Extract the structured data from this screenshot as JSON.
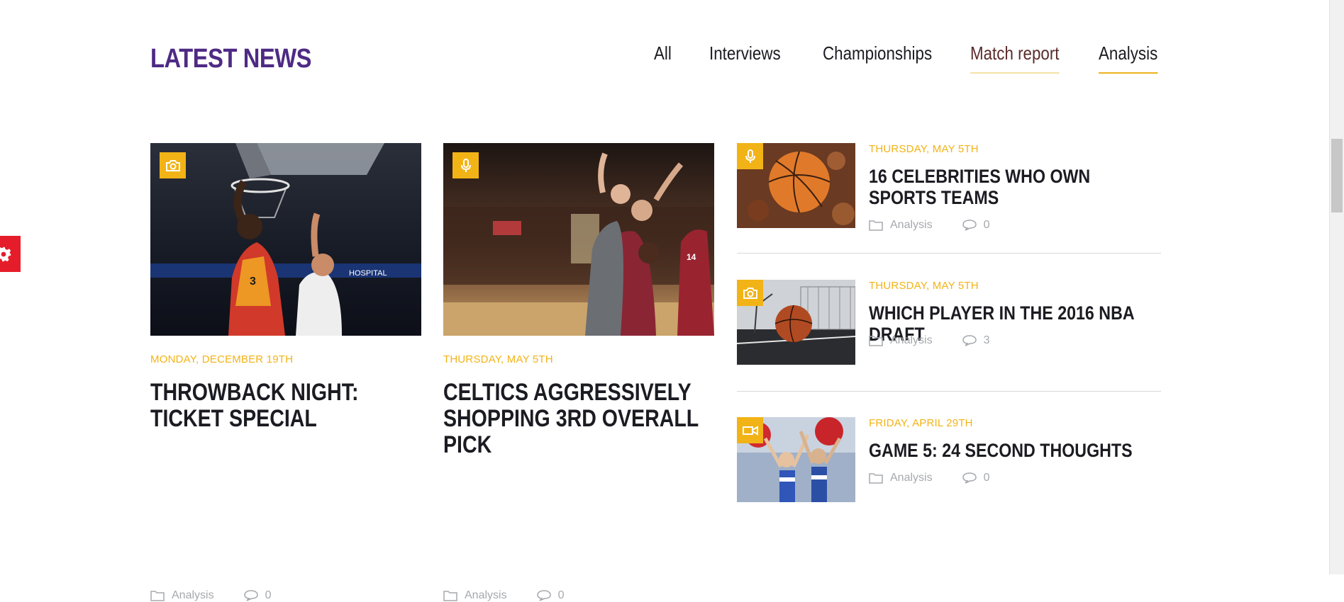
{
  "header": {
    "title": "LATEST NEWS"
  },
  "filter_tabs": [
    {
      "label": "All",
      "state": "normal"
    },
    {
      "label": "Interviews",
      "state": "normal"
    },
    {
      "label": "Championships",
      "state": "normal"
    },
    {
      "label": "Match report",
      "state": "hover"
    },
    {
      "label": "Analysis",
      "state": "active"
    }
  ],
  "colors": {
    "title_purple": "#4e2a84",
    "accent_yellow": "#f2b316",
    "settings_red": "#e51d2a",
    "meta_gray": "#a5a8ad"
  },
  "cards": [
    {
      "badge_icon": "camera-icon",
      "date": "MONDAY, DECEMBER 19TH",
      "title": "THROWBACK NIGHT: TICKET SPECIAL",
      "category": "Analysis",
      "comments": "0"
    },
    {
      "badge_icon": "microphone-icon",
      "date": "THURSDAY, MAY 5TH",
      "title": "CELTICS AGGRESSIVELY SHOPPING 3RD OVERALL PICK",
      "category": "Analysis",
      "comments": "0"
    }
  ],
  "side_list": [
    {
      "badge_icon": "microphone-icon",
      "date": "THURSDAY, MAY 5TH",
      "title": "16 CELEBRITIES WHO OWN SPORTS TEAMS",
      "category": "Analysis",
      "comments": "0"
    },
    {
      "badge_icon": "camera-icon",
      "date": "THURSDAY, MAY 5TH",
      "title": "WHICH PLAYER IN THE 2016 NBA DRAFT",
      "category": "Analysis",
      "comments": "3"
    },
    {
      "badge_icon": "video-camera-icon",
      "date": "FRIDAY, APRIL 29TH",
      "title": "GAME 5: 24 SECOND THOUGHTS",
      "category": "Analysis",
      "comments": "0"
    }
  ],
  "settings": {
    "icon": "gear-icon"
  }
}
